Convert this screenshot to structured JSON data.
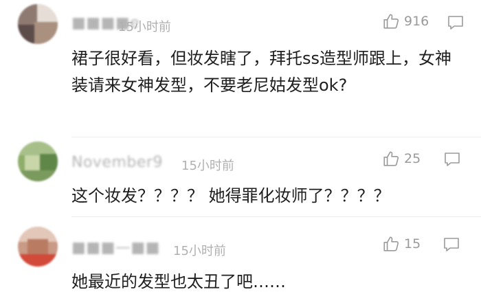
{
  "comments": [
    {
      "username": "■■■■e",
      "time": "15小时前",
      "likes": "916",
      "text": "裙子很好看，但妆发瞎了，拜托ss造型师跟上，女神装请来女神发型，不要老尼姑发型ok?"
    },
    {
      "username": "November9",
      "time": "15小时前",
      "likes": "25",
      "text": "这个妆发？？？？ 她得罪化妆师了？？？？"
    },
    {
      "username": "■■■—■■",
      "time": "15小时前",
      "likes": "15",
      "text": "她最近的发型也太丑了吧……"
    }
  ],
  "icons": {
    "like": "thumbs-up-icon",
    "reply": "comment-bubble-icon"
  },
  "colors": {
    "meta_gray": "#b0b0b0",
    "text": "#1e1e1e"
  }
}
